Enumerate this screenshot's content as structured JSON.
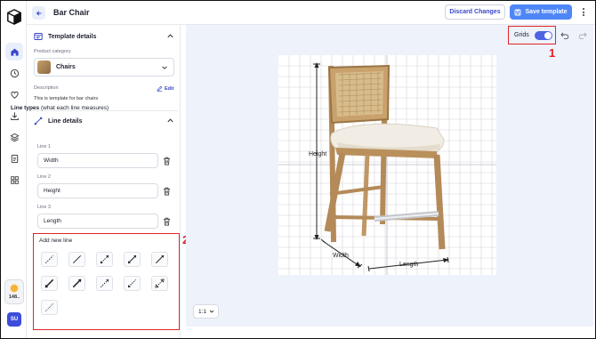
{
  "header": {
    "title": "Bar Chair",
    "discard_label": "Discard Changes",
    "save_label": "Save template"
  },
  "rail": {
    "credits": "148..",
    "avatar_initials": "SU",
    "items": [
      "home-icon",
      "history-icon",
      "heart-icon",
      "download-icon",
      "layers-icon",
      "document-icon",
      "grid-icon"
    ]
  },
  "template_details": {
    "title": "Template details",
    "category_label": "Product category",
    "category_value": "Chairs",
    "description_label": "Description",
    "edit_label": "Edit",
    "description_value": "This is template for bar chairs"
  },
  "line_details": {
    "title": "Line details",
    "types_title_bold": "Line types",
    "types_title_rest": " (what each line measures)",
    "lines": [
      {
        "label": "Line 1",
        "value": "Width"
      },
      {
        "label": "Line 2",
        "value": "Height"
      },
      {
        "label": "Line 3",
        "value": "Length"
      }
    ]
  },
  "add_line": {
    "title": "Add new line",
    "tools": [
      "dashed-line-icon",
      "solid-line-icon",
      "dashed-arrow-both-icon",
      "solid-arrow-both-icon",
      "solid-arrow-end-icon",
      "bold-arrow-start-icon",
      "bold-arrow-end-icon",
      "dashed-arrow-end-icon",
      "dashed-arrow-start-icon",
      "outline-arrow-both-icon",
      "dotted-line-icon"
    ]
  },
  "canvas": {
    "grids_label": "Grids",
    "grids_on": true,
    "zoom": "1:1",
    "dimension_labels": {
      "height": "Height",
      "width": "Width",
      "length": "Length"
    },
    "annotation_markers": [
      "1",
      "2"
    ]
  },
  "colors": {
    "accent": "#4f63e0",
    "primary_button": "#4f86f7",
    "highlight": "#e0242b"
  }
}
